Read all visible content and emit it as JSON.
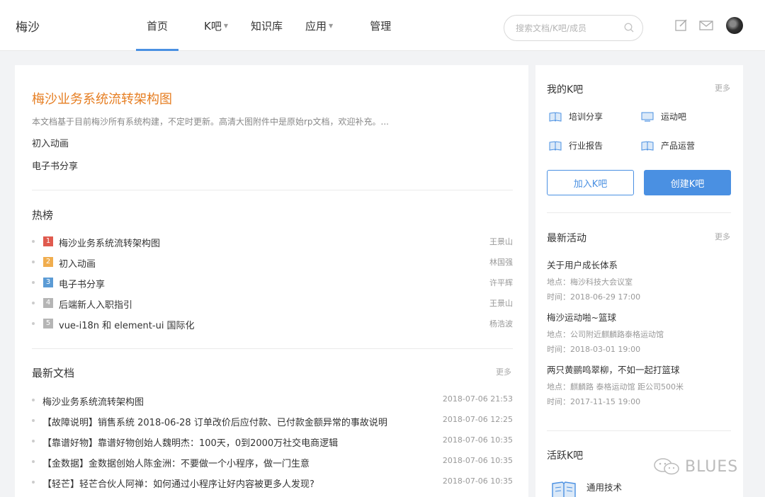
{
  "header": {
    "logo": "梅沙",
    "nav": [
      {
        "label": "首页",
        "caret": false,
        "active": true
      },
      {
        "label": "K吧",
        "caret": true,
        "active": false
      },
      {
        "label": "知识库",
        "caret": false,
        "active": false
      },
      {
        "label": "应用",
        "caret": true,
        "active": false
      },
      {
        "label": "管理",
        "caret": false,
        "active": false
      }
    ],
    "search_placeholder": "搜索文档/K吧/成员",
    "icons": [
      "edit-icon",
      "mail-icon",
      "avatar"
    ]
  },
  "main": {
    "doc_title": "梅沙业务系统流转架构图",
    "doc_desc": "本文档基于目前梅沙所有系统构建，不定时更新。高清大图附件中是原始rp文档，欢迎补充。...",
    "links": [
      "初入动画",
      "电子书分享"
    ],
    "hot": {
      "title": "热榜",
      "items": [
        {
          "rank": "1",
          "title": "梅沙业务系统流转架构图",
          "author": "王景山",
          "color": "#e05a4e"
        },
        {
          "rank": "2",
          "title": "初入动画",
          "author": "林国强",
          "color": "#f0ad4e"
        },
        {
          "rank": "3",
          "title": "电子书分享",
          "author": "许平辉",
          "color": "#5b9bd5"
        },
        {
          "rank": "4",
          "title": "后端新人入职指引",
          "author": "王景山",
          "color": "#b5b5b5"
        },
        {
          "rank": "5",
          "title": "vue-i18n 和 element-ui 国际化",
          "author": "杨浩波",
          "color": "#b5b5b5"
        }
      ]
    },
    "latest_docs": {
      "title": "最新文档",
      "more": "更多",
      "items": [
        {
          "title": "梅沙业务系统流转架构图",
          "date": "2018-07-06 21:53"
        },
        {
          "title": "【故障说明】销售系统 2018-06-28 订单改价后应付款、已付款金额异常的事故说明",
          "date": "2018-07-06 12:25"
        },
        {
          "title": "【靠谱好物】靠谱好物创始人魏明杰：100天，0到2000万社交电商逻辑",
          "date": "2018-07-06 10:35"
        },
        {
          "title": "【金数据】金数据创始人陈金洲：不要做一个小程序，做一门生意",
          "date": "2018-07-06 10:35"
        },
        {
          "title": "【轻芒】轻芒合伙人阿禅：如何通过小程序让好内容被更多人发现?",
          "date": "2018-07-06 10:35"
        }
      ]
    }
  },
  "side": {
    "my_k": {
      "title": "我的K吧",
      "more": "更多",
      "items": [
        "培训分享",
        "运动吧",
        "行业报告",
        "产品运营"
      ]
    },
    "join_label": "加入K吧",
    "create_label": "创建K吧",
    "events": {
      "title": "最新活动",
      "more": "更多",
      "items": [
        {
          "title": "关于用户成长体系",
          "place": "地点：梅沙科技大会议室",
          "time": "时间：2018-06-29 17:00"
        },
        {
          "title": "梅沙运动啪~篮球",
          "place": "地点：公司附近麒麟路泰格运动馆",
          "time": "时间：2018-03-01 19:00"
        },
        {
          "title": "两只黄鹂鸣翠柳，不如一起打篮球",
          "place": "地点：麒麟路 泰格运动馆 距公司500米",
          "time": "时间：2017-11-15 19:00"
        }
      ]
    },
    "active_k": {
      "title": "活跃K吧",
      "item": "通用技术"
    }
  },
  "watermark": "BLUES",
  "colors": {
    "accent": "#4a90e2",
    "title_orange": "#e67e22"
  }
}
